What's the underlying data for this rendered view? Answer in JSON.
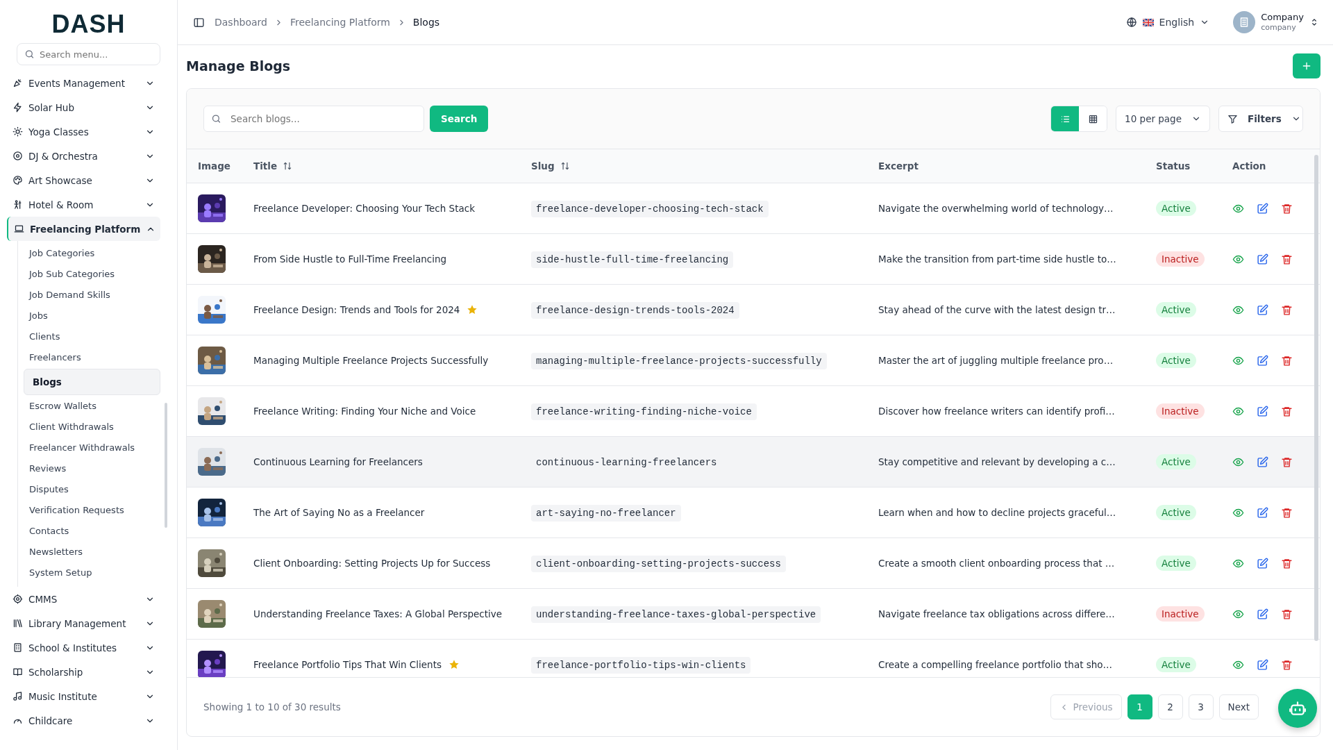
{
  "sidebar": {
    "logo": "DASH",
    "search": {
      "placeholder": "Search menu..."
    },
    "items": [
      {
        "label": "Events Management",
        "expanded": false
      },
      {
        "label": "Solar Hub",
        "expanded": false
      },
      {
        "label": "Yoga Classes",
        "expanded": false
      },
      {
        "label": "DJ & Orchestra",
        "expanded": false
      },
      {
        "label": "Art Showcase",
        "expanded": false
      },
      {
        "label": "Hotel & Room",
        "expanded": false
      },
      {
        "label": "Freelancing Platform",
        "expanded": true,
        "children": [
          {
            "label": "Job Categories",
            "selected": false
          },
          {
            "label": "Job Sub Categories",
            "selected": false
          },
          {
            "label": "Job Demand Skills",
            "selected": false
          },
          {
            "label": "Jobs",
            "selected": false
          },
          {
            "label": "Clients",
            "selected": false
          },
          {
            "label": "Freelancers",
            "selected": false
          },
          {
            "label": "Blogs",
            "selected": true
          },
          {
            "label": "Escrow Wallets",
            "selected": false
          },
          {
            "label": "Client Withdrawals",
            "selected": false
          },
          {
            "label": "Freelancer Withdrawals",
            "selected": false
          },
          {
            "label": "Reviews",
            "selected": false
          },
          {
            "label": "Disputes",
            "selected": false
          },
          {
            "label": "Verification Requests",
            "selected": false
          },
          {
            "label": "Contacts",
            "selected": false
          },
          {
            "label": "Newsletters",
            "selected": false
          },
          {
            "label": "System Setup",
            "selected": false
          }
        ]
      },
      {
        "label": "CMMS",
        "expanded": false
      },
      {
        "label": "Library Management",
        "expanded": false
      },
      {
        "label": "School & Institutes",
        "expanded": false
      },
      {
        "label": "Scholarship",
        "expanded": false
      },
      {
        "label": "Music Institute",
        "expanded": false
      },
      {
        "label": "Childcare",
        "expanded": false
      }
    ]
  },
  "header": {
    "breadcrumbs": [
      "Dashboard",
      "Freelancing Platform",
      "Blogs"
    ],
    "language": "English",
    "user": {
      "name": "Company",
      "role": "company"
    }
  },
  "page": {
    "title": "Manage Blogs"
  },
  "toolbar": {
    "search": {
      "placeholder": "Search blogs..."
    },
    "search_button": "Search",
    "views": [
      {
        "kind": "list",
        "selected": true
      },
      {
        "kind": "grid",
        "selected": false
      }
    ],
    "per_page": "10 per page",
    "filters": "Filters"
  },
  "table": {
    "columns": [
      {
        "label": "Image",
        "sortable": false
      },
      {
        "label": "Title",
        "sortable": true
      },
      {
        "label": "Slug",
        "sortable": true
      },
      {
        "label": "Excerpt",
        "sortable": false
      },
      {
        "label": "Status",
        "sortable": false
      },
      {
        "label": "Action",
        "sortable": false
      }
    ],
    "rows": [
      {
        "title": "Freelance Developer: Choosing Your Tech Stack",
        "featured": false,
        "slug": "freelance-developer-choosing-tech-stack",
        "excerpt": "Navigate the overwhelming world of technology…",
        "status": "Active",
        "active": true,
        "hovered": false
      },
      {
        "title": "From Side Hustle to Full-Time Freelancing",
        "featured": false,
        "slug": "side-hustle-full-time-freelancing",
        "excerpt": "Make the transition from part-time side hustle to…",
        "status": "Inactive",
        "active": false,
        "hovered": false
      },
      {
        "title": "Freelance Design: Trends and Tools for 2024",
        "featured": true,
        "slug": "freelance-design-trends-tools-2024",
        "excerpt": "Stay ahead of the curve with the latest design tr…",
        "status": "Active",
        "active": true,
        "hovered": false
      },
      {
        "title": "Managing Multiple Freelance Projects Successfully",
        "featured": false,
        "slug": "managing-multiple-freelance-projects-successfully",
        "excerpt": "Master the art of juggling multiple freelance pro…",
        "status": "Active",
        "active": true,
        "hovered": false
      },
      {
        "title": "Freelance Writing: Finding Your Niche and Voice",
        "featured": false,
        "slug": "freelance-writing-finding-niche-voice",
        "excerpt": "Discover how freelance writers can identify profi…",
        "status": "Inactive",
        "active": false,
        "hovered": false
      },
      {
        "title": "Continuous Learning for Freelancers",
        "featured": false,
        "slug": "continuous-learning-freelancers",
        "excerpt": "Stay competitive and relevant by developing a c…",
        "status": "Active",
        "active": true,
        "hovered": true
      },
      {
        "title": "The Art of Saying No as a Freelancer",
        "featured": false,
        "slug": "art-saying-no-freelancer",
        "excerpt": "Learn when and how to decline projects graceful…",
        "status": "Active",
        "active": true,
        "hovered": false
      },
      {
        "title": "Client Onboarding: Setting Projects Up for Success",
        "featured": false,
        "slug": "client-onboarding-setting-projects-success",
        "excerpt": "Create a smooth client onboarding process that …",
        "status": "Active",
        "active": true,
        "hovered": false
      },
      {
        "title": "Understanding Freelance Taxes: A Global Perspective",
        "featured": false,
        "slug": "understanding-freelance-taxes-global-perspective",
        "excerpt": "Navigate freelance tax obligations across differe…",
        "status": "Inactive",
        "active": false,
        "hovered": false
      },
      {
        "title": "Freelance Portfolio Tips That Win Clients",
        "featured": true,
        "slug": "freelance-portfolio-tips-win-clients",
        "excerpt": "Create a compelling freelance portfolio that sho…",
        "status": "Active",
        "active": true,
        "hovered": false
      }
    ]
  },
  "footer": {
    "summary": "Showing 1 to 10 of 30 results",
    "previous": "Previous",
    "pages": [
      {
        "label": "1",
        "selected": true
      },
      {
        "label": "2",
        "selected": false
      },
      {
        "label": "3",
        "selected": false
      }
    ],
    "next": "Next"
  }
}
